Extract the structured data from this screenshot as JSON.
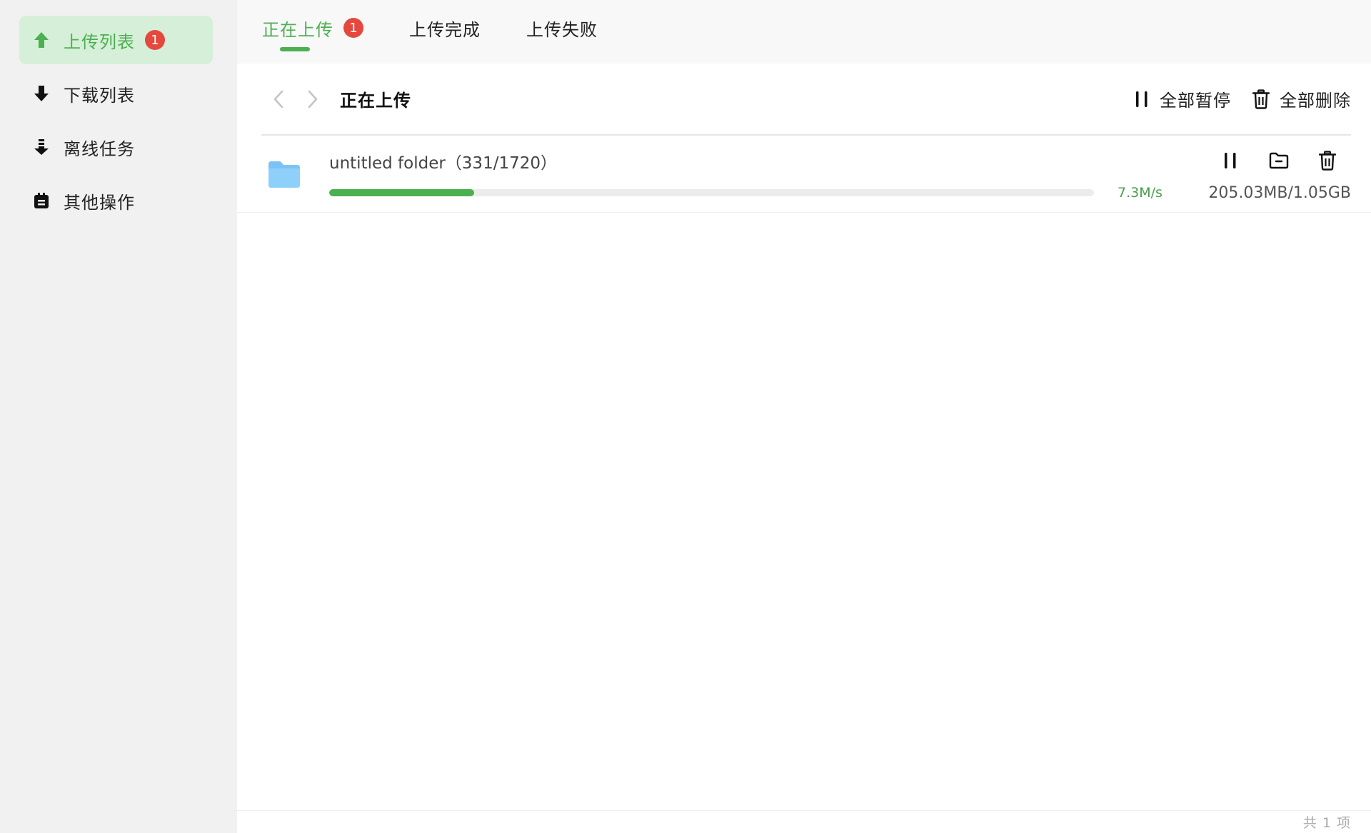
{
  "colors": {
    "accent": "#4caf50",
    "sidebar_active_bg": "#d6efd8",
    "badge": "#e5483d",
    "folder": "#7cc3f5"
  },
  "sidebar": {
    "items": [
      {
        "label": "上传列表",
        "icon": "upload-arrow-icon",
        "badge": "1",
        "active": true
      },
      {
        "label": "下载列表",
        "icon": "download-arrow-icon",
        "active": false
      },
      {
        "label": "离线任务",
        "icon": "offline-download-icon",
        "active": false
      },
      {
        "label": "其他操作",
        "icon": "clipboard-icon",
        "active": false
      }
    ]
  },
  "tabs": [
    {
      "label": "正在上传",
      "badge": "1",
      "active": true
    },
    {
      "label": "上传完成",
      "active": false
    },
    {
      "label": "上传失败",
      "active": false
    }
  ],
  "toolbar": {
    "title": "正在上传",
    "pause_all_label": "全部暂停",
    "delete_all_label": "全部删除"
  },
  "uploads": [
    {
      "name": "untitled folder（331/1720）",
      "icon": "folder-icon",
      "progress": 0.19,
      "speed": "7.3M/s",
      "size": "205.03MB/1.05GB"
    }
  ],
  "footer": {
    "count_text": "共 1 项"
  }
}
